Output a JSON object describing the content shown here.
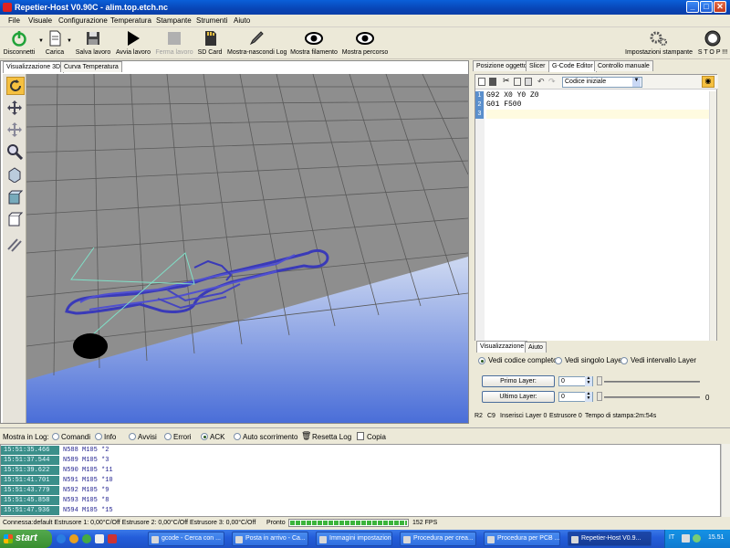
{
  "window": {
    "title": "Repetier-Host V0.90C - alim.top.etch.nc"
  },
  "menu": [
    "File",
    "Visuale",
    "Configurazione",
    "Temperatura",
    "Stampante",
    "Strumenti",
    "Aiuto"
  ],
  "toolbar": {
    "disconnect": "Disconnetti",
    "load": "Carica",
    "save_job": "Salva lavoro",
    "start_job": "Avvia lavoro",
    "stop_job": "Ferma lavoro",
    "sd_card": "SD Card",
    "toggle_log": "Mostra-nascondi Log",
    "show_filament": "Mostra filamento",
    "show_path": "Mostra percorso",
    "printer_settings": "Impostazioni stampante",
    "stop": "S T O P !!!"
  },
  "left_tabs": [
    "Visualizzazione 3D",
    "Curva Temperatura"
  ],
  "right_tabs": [
    "Posizione oggetto",
    "Slicer",
    "G-Code Editor",
    "Controllo manuale"
  ],
  "editor": {
    "section_select": "Codice iniziale",
    "lines": [
      {
        "num": "1",
        "text": "G92 X0 Y0 Z0"
      },
      {
        "num": "2",
        "text": "G01 F500"
      },
      {
        "num": "3",
        "text": ""
      }
    ]
  },
  "visual_panel": {
    "tabs": [
      "Visualizzazione",
      "Aiuto"
    ],
    "radios": [
      "Vedi codice completo",
      "Vedi singolo Layer",
      "Vedi intervallo Layer"
    ],
    "first_layer_label": "Primo Layer:",
    "first_layer_value": "0",
    "last_layer_label": "Ultimo Layer:",
    "last_layer_value": "0",
    "last_layer_slider_value": "0"
  },
  "editor_status": {
    "position": "R2",
    "column": "C9",
    "mode": "Inserisci",
    "layer": "Layer 0",
    "extruder": "Estrusore 0",
    "print_time": "Tempo di stampa:2m:54s"
  },
  "log_filter": {
    "label": "Mostra in Log:",
    "options": [
      "Comandi",
      "Info",
      "Avvisi",
      "Errori",
      "ACK",
      "Auto scorrimento"
    ],
    "reset": "Resetta Log",
    "copy": "Copia"
  },
  "log": [
    {
      "time": "15:51:35.466",
      "msg": "N588 M105 *2"
    },
    {
      "time": "15:51:37.544",
      "msg": "N589 M105 *3"
    },
    {
      "time": "15:51:39.622",
      "msg": "N590 M105 *11"
    },
    {
      "time": "15:51:41.701",
      "msg": "N591 M105 *10"
    },
    {
      "time": "15:51:43.779",
      "msg": "N592 M105 *9"
    },
    {
      "time": "15:51:45.858",
      "msg": "N593 M105 *8"
    },
    {
      "time": "15:51:47.936",
      "msg": "N594 M105 *15"
    }
  ],
  "statusbar": {
    "connection": "Connessa:default  Estrusore 1: 0,00°C/Off Estrusore 2: 0,00°C/Off Estrusore 3: 0,00°C/Off",
    "ready": "Pronto",
    "fps": "152 FPS"
  },
  "taskbar": {
    "start": "start",
    "tasks": [
      "gcode - Cerca con ...",
      "Posta in arrivo - Ca...",
      "Immagini impostazioni",
      "Procedura per crea...",
      "Procedura per PCB ...",
      "Repetier-Host V0.9..."
    ],
    "lang": "IT",
    "clock": "15.51"
  }
}
